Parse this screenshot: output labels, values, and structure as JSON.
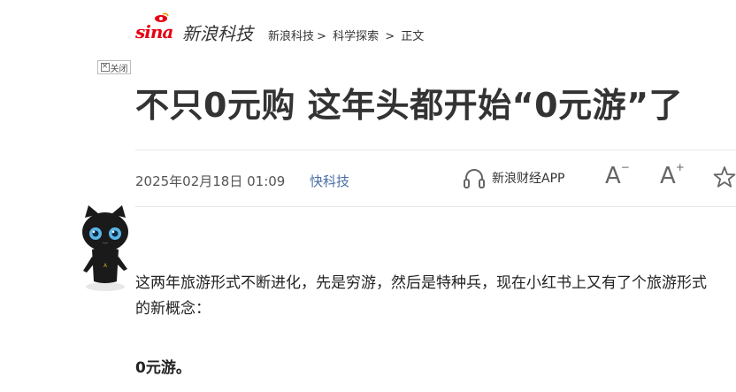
{
  "brand": {
    "latin": "sina",
    "chinese": "新浪科技"
  },
  "breadcrumb": [
    "新浪科技",
    ">",
    "科学探索",
    ">",
    "正文"
  ],
  "ad_close_label": "关闭",
  "article": {
    "title": "不只0元购 这年头都开始“0元游”了",
    "date": "2025年02月18日 01:09",
    "source": "快科技",
    "paragraph": "这两年旅游形式不断进化，先是穷游，然后是特种兵，现在小红书上又有了个旅游形式的新概念：",
    "bold_line": "0元游。"
  },
  "toolbar": {
    "app_label": "新浪财经APP",
    "font_smaller_glyph": "A",
    "font_smaller_mark": "−",
    "font_larger_glyph": "A",
    "font_larger_mark": "+"
  },
  "colors": {
    "brand_red": "#e60012",
    "source_blue": "#4a6fa5",
    "text": "#333333"
  },
  "icons": [
    "sina-eye-icon",
    "close-icon",
    "headphones-icon",
    "font-smaller-icon",
    "font-larger-icon",
    "star-icon",
    "cat-mascot"
  ]
}
